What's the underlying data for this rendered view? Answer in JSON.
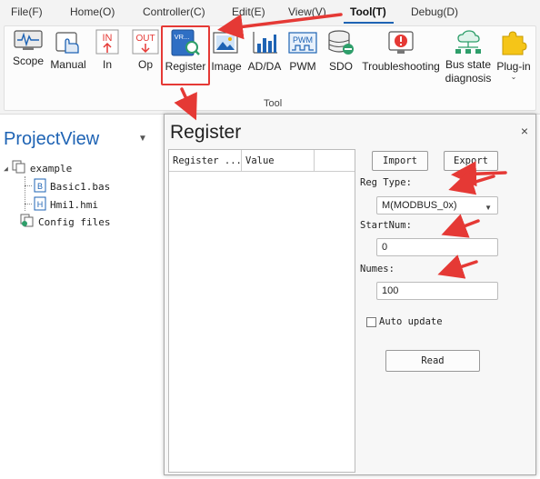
{
  "menu": {
    "items": [
      {
        "label": "File(F)"
      },
      {
        "label": "Home(O)"
      },
      {
        "label": "Controller(C)"
      },
      {
        "label": "Edit(E)"
      },
      {
        "label": "View(V)"
      },
      {
        "label": "Tool(T)"
      },
      {
        "label": "Debug(D)"
      }
    ],
    "active": "Tool(T)"
  },
  "ribbon": {
    "group_label": "Tool",
    "tools": [
      {
        "label": "Scope",
        "icon": "scope-icon"
      },
      {
        "label": "Manual",
        "icon": "hand-icon"
      },
      {
        "label": "In",
        "icon": "input-icon",
        "icon_text": "IN"
      },
      {
        "label": "Op",
        "icon": "output-icon",
        "icon_text": "OUT"
      },
      {
        "label": "Register",
        "icon": "register-icon",
        "icon_text": "VR..."
      },
      {
        "label": "Image",
        "icon": "image-icon"
      },
      {
        "label": "AD/DA",
        "icon": "chart-icon"
      },
      {
        "label": "PWM",
        "icon": "pwm-icon",
        "icon_text": "PWM"
      },
      {
        "label": "SDO",
        "icon": "database-icon"
      },
      {
        "label": "Troubleshooting",
        "icon": "alert-icon"
      },
      {
        "label": "Bus state diagnosis",
        "label_line1": "Bus state",
        "label_line2": "diagnosis",
        "icon": "network-icon"
      },
      {
        "label": "Plug-in",
        "icon": "puzzle-icon"
      }
    ]
  },
  "project_view": {
    "title": "ProjectView",
    "tree": {
      "root": "example",
      "files": [
        "Basic1.bas",
        "Hmi1.hmi"
      ],
      "config": "Config files"
    }
  },
  "register_dialog": {
    "title": "Register",
    "close": "×",
    "columns": [
      "Register ...",
      "Value"
    ],
    "import_label": "Import",
    "export_label": "Export",
    "reg_type_label": "Reg Type:",
    "reg_type_value": "M(MODBUS_0x)",
    "start_num_label": "StartNum:",
    "start_num_value": "0",
    "numes_label": "Numes:",
    "numes_value": "100",
    "auto_update_label": "Auto update",
    "auto_update_checked": false,
    "read_label": "Read"
  },
  "colors": {
    "accent": "#1e63b4",
    "annotation": "#e53935",
    "menu_bg": "#f3f3f3",
    "dialog_bg": "#f7f7f7"
  }
}
